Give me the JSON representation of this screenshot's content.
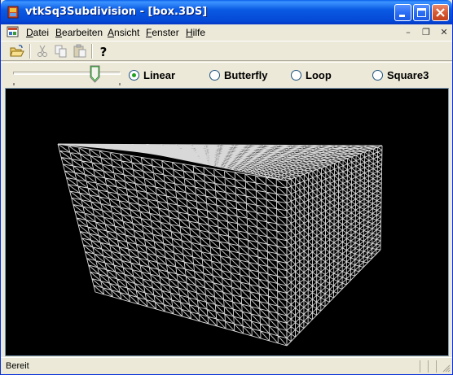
{
  "window": {
    "title": "vtkSq3Subdivision - [box.3DS]"
  },
  "menu": {
    "items": [
      {
        "underline": "D",
        "rest": "atei"
      },
      {
        "underline": "B",
        "rest": "earbeiten"
      },
      {
        "underline": "A",
        "rest": "nsicht"
      },
      {
        "underline": "F",
        "rest": "enster"
      },
      {
        "underline": "H",
        "rest": "ilfe"
      }
    ],
    "mdi_buttons": [
      "–",
      "❐",
      "✕"
    ]
  },
  "toolbar": {
    "buttons": [
      "open-icon",
      "cut-icon",
      "copy-icon",
      "paste-icon",
      "help-icon"
    ]
  },
  "options": {
    "slider_fraction": 0.82,
    "radios": [
      {
        "label": "Linear",
        "selected": true
      },
      {
        "label": "Butterfly",
        "selected": false
      },
      {
        "label": "Loop",
        "selected": false
      },
      {
        "label": "Square3",
        "selected": false
      }
    ]
  },
  "viewport": {
    "background": "#000000",
    "mesh_color": "#d8d8d8",
    "object": "subdivided-box-mesh"
  },
  "status": {
    "text": "Bereit"
  },
  "colors": {
    "titlebar": "#0548d6",
    "face": "#ece9d8",
    "radio_dot": "#21a121"
  }
}
